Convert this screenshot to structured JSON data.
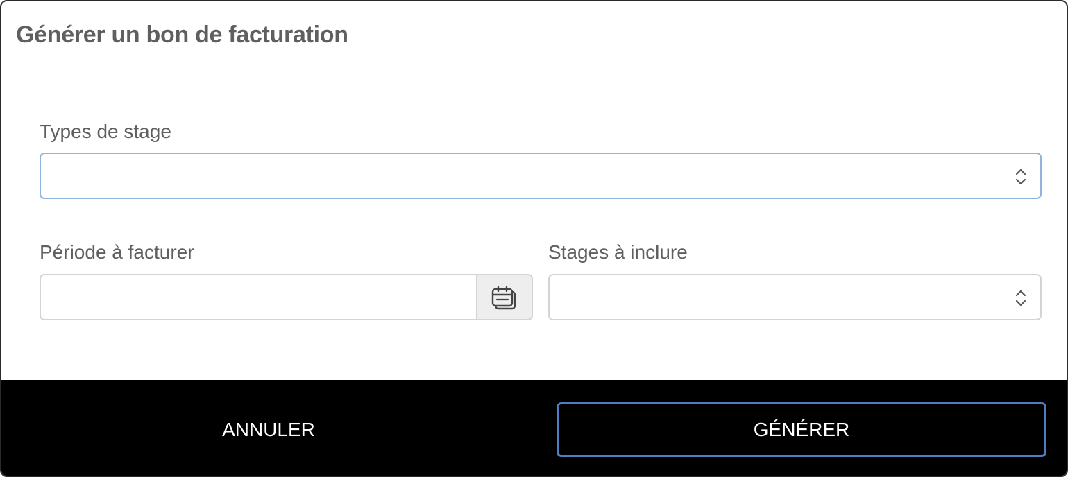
{
  "dialog": {
    "title": "Générer un bon de facturation"
  },
  "form": {
    "types_de_stage": {
      "label": "Types de stage",
      "value": "",
      "icon": "chevron-up-down-icon"
    },
    "periode": {
      "label": "Période à facturer",
      "value": "",
      "placeholder": "",
      "icon": "calendar-icon"
    },
    "stages_a_inclure": {
      "label": "Stages à inclure",
      "value": "",
      "icon": "chevron-up-down-icon"
    }
  },
  "footer": {
    "cancel_label": "ANNULER",
    "generate_label": "GÉNÉRER"
  },
  "colors": {
    "focus_border": "#8fb4dd",
    "primary_border": "#4d7ec4",
    "footer_bg": "#000000",
    "label_text": "#5f5f5f"
  }
}
